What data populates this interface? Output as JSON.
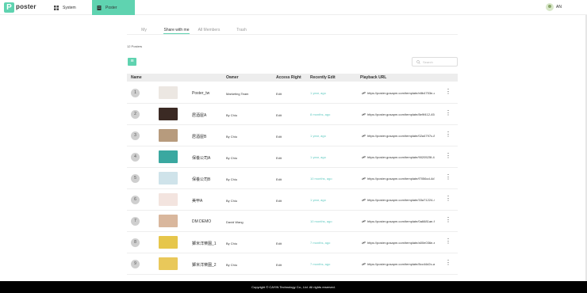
{
  "app": {
    "logo_letter": "P",
    "logo_text": "poster",
    "accent_color": "#5fd3b0"
  },
  "nav": {
    "system_label": "System",
    "system_icon": "grid-icon",
    "poster_label": "Poster",
    "poster_icon": "document-icon"
  },
  "user": {
    "name": "AN"
  },
  "tabs": [
    "My",
    "Share with me",
    "All Members",
    "Trash"
  ],
  "active_tab": "Share with me",
  "posters_count": "12 Posters",
  "search": {
    "placeholder": "Search"
  },
  "table": {
    "headers": {
      "name": "Name",
      "owner": "Owner",
      "access": "Access Right",
      "recent": "Recently Edit",
      "url": "Playback URL"
    },
    "rows": [
      {
        "num": "1",
        "name": "Poster_tw",
        "owner": "Marketing Team",
        "access": "Edit",
        "recent": "1 year, ago",
        "url": "https://poster.gosapm.com/template/e8b4753e-c3f...",
        "thumb_color": "#ece7e2"
      },
      {
        "num": "2",
        "name": "居酒屋A",
        "owner": "By Chiu",
        "access": "Edit",
        "recent": "8 months, ago",
        "url": "https://poster.gosapm.com/template/8e9f412-45e...",
        "thumb_color": "#3b2a24"
      },
      {
        "num": "3",
        "name": "居酒屋B",
        "owner": "By Chiu",
        "access": "Edit",
        "recent": "1 year, ago",
        "url": "https://poster.gosapm.com/template/02a4797c-87e...",
        "thumb_color": "#b79b7d"
      },
      {
        "num": "4",
        "name": "保養公司A",
        "owner": "By Chiu",
        "access": "Edit",
        "recent": "1 year, ago",
        "url": "https://poster.gosapm.com/template/9020525f-4d...",
        "thumb_color": "#3aa8a0"
      },
      {
        "num": "5",
        "name": "保養公司B",
        "owner": "By Chiu",
        "access": "Edit",
        "recent": "10 months, ago",
        "url": "https://poster.gosapm.com/template/f7056cd-4d7...",
        "thumb_color": "#cfe3ea"
      },
      {
        "num": "6",
        "name": "美甲A",
        "owner": "By Chiu",
        "access": "Edit",
        "recent": "1 year, ago",
        "url": "https://poster.gosapm.com/template/33a71224-4e8...",
        "thumb_color": "#f3e4df"
      },
      {
        "num": "7",
        "name": "DM DEMO",
        "owner": "David Wang",
        "access": "",
        "recent": "10 months, ago",
        "url": "https://poster.gosapm.com/template/0a6681ae-f31...",
        "thumb_color": "#d9b79d"
      },
      {
        "num": "8",
        "name": "獅米洋樂園_1",
        "owner": "By Chiu",
        "access": "Edit",
        "recent": "7 months, ago",
        "url": "https://poster.gosapm.com/template/a00e036e-e34...",
        "thumb_color": "#e6c64b"
      },
      {
        "num": "9",
        "name": "獅米洋樂園_2",
        "owner": "By Chiu",
        "access": "Edit",
        "recent": "7 months, ago",
        "url": "https://poster.gosapm.com/template/8cc44d2c-a4c...",
        "thumb_color": "#e9c85a"
      }
    ]
  },
  "footer": {
    "text": "Copyright © CAYIN Technology Co., Ltd. All rights reserved."
  }
}
